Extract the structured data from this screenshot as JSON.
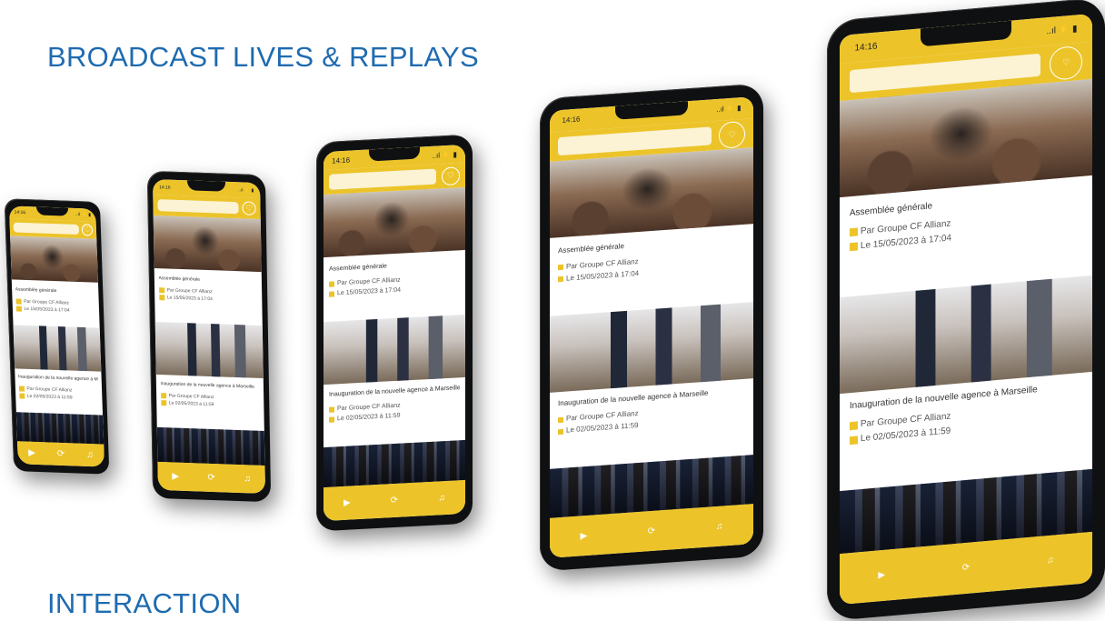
{
  "headings": {
    "top": "BROADCAST LIVES & REPLAYS",
    "bottom": "INTERACTION"
  },
  "colors": {
    "heading": "#1f6bb0",
    "accent": "#ecc42a"
  },
  "phone_screen": {
    "status_time": "14:16",
    "status_icons": "..ıl ⚡ ▮",
    "favorite_icon": "heart-icon",
    "cards": [
      {
        "title": "Assemblée générale",
        "meta": [
          "Par Groupe CF Allianz",
          "Le 15/05/2023 à 17:04"
        ]
      },
      {
        "title": "Inauguration de la nouvelle agence à Marseille",
        "meta": [
          "Par Groupe CF Allianz",
          "Le 02/05/2023 à 11:59"
        ]
      }
    ],
    "nav_icons": [
      "play-icon",
      "refresh-icon",
      "bell-icon"
    ]
  }
}
